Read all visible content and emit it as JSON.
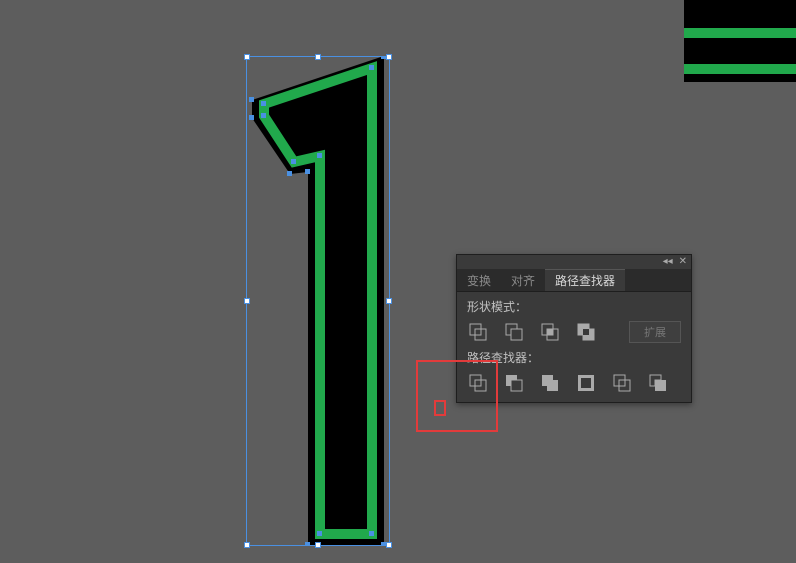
{
  "panel": {
    "tabs": [
      {
        "label": "变换",
        "active": false
      },
      {
        "label": "对齐",
        "active": false
      },
      {
        "label": "路径查找器",
        "active": true
      }
    ],
    "shape_modes_label": "形状模式：",
    "pathfinders_label": "路径查找器：",
    "expand_label": "扩展",
    "shape_mode_buttons": [
      "unite",
      "minus-front",
      "intersect",
      "exclude"
    ],
    "pathfinder_buttons": [
      "divide",
      "trim",
      "merge",
      "crop",
      "outline",
      "minus-back"
    ]
  },
  "colors": {
    "accent_green": "#21a94c",
    "selection_blue": "#4a90e2",
    "annotation_red": "#e23b3b"
  }
}
